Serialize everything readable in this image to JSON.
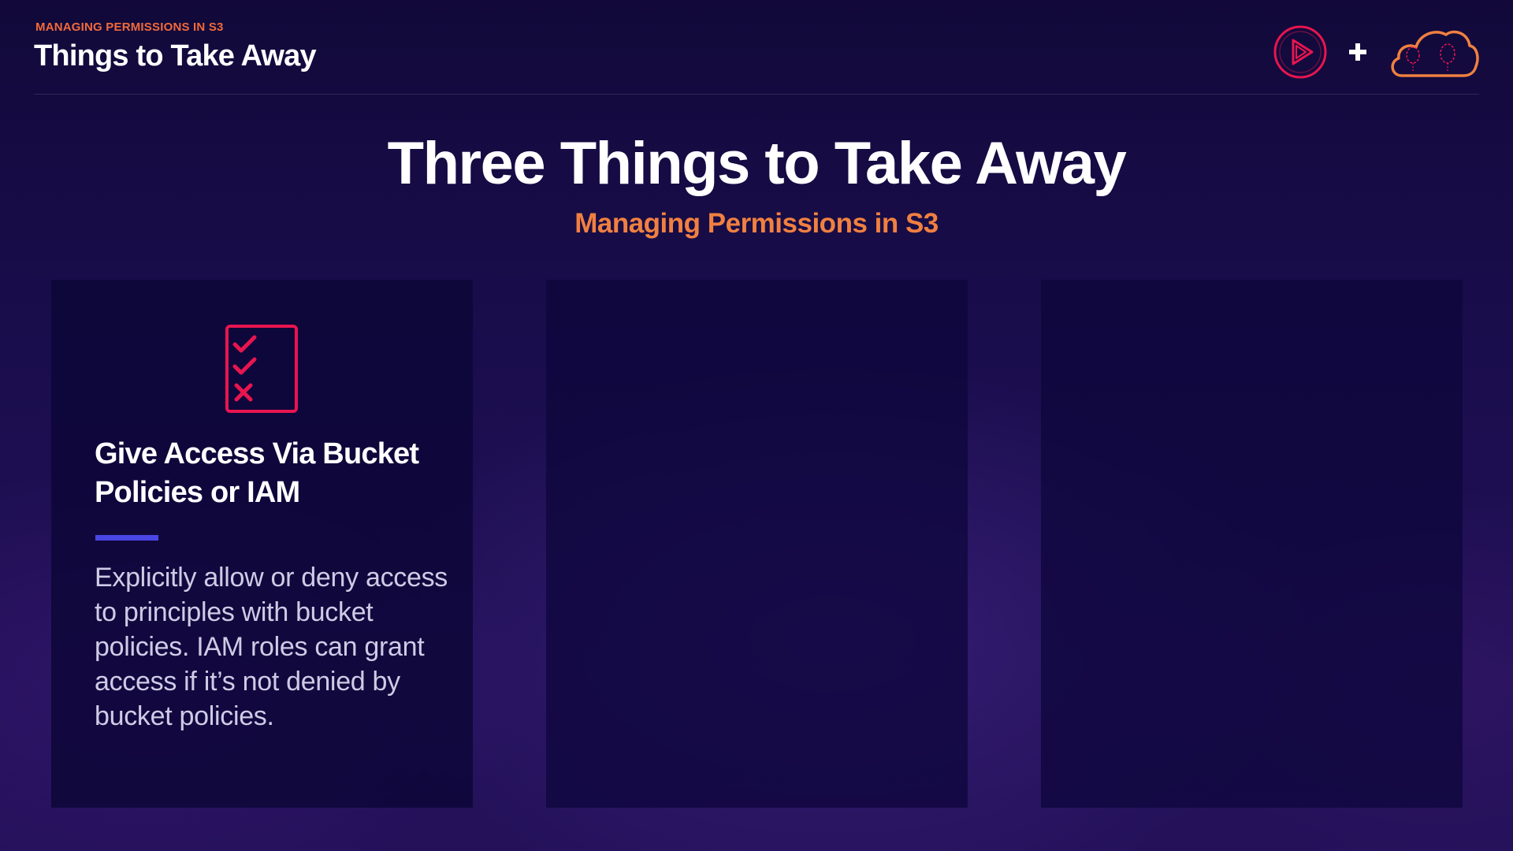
{
  "header": {
    "eyebrow": "MANAGING PERMISSIONS IN S3",
    "title": "Things to Take Away"
  },
  "logos": {
    "play_icon": "play-triangle-circle",
    "plus_icon": "plus",
    "cloud_icon": "cloud-with-balloons"
  },
  "main": {
    "title": "Three Things to Take Away",
    "subtitle": "Managing Permissions in S3"
  },
  "cards": [
    {
      "icon": "checklist-icon",
      "title": "Give Access Via Bucket Policies or IAM",
      "body": "Explicitly allow or deny access to principles with bucket policies. IAM roles can grant access if it’s not denied by bucket policies."
    },
    {},
    {}
  ],
  "colors": {
    "accent_orange": "#f06a3a",
    "icon_pink": "#e8154f",
    "accent_blue": "#4a46e6",
    "background": "#1a0d4d"
  }
}
